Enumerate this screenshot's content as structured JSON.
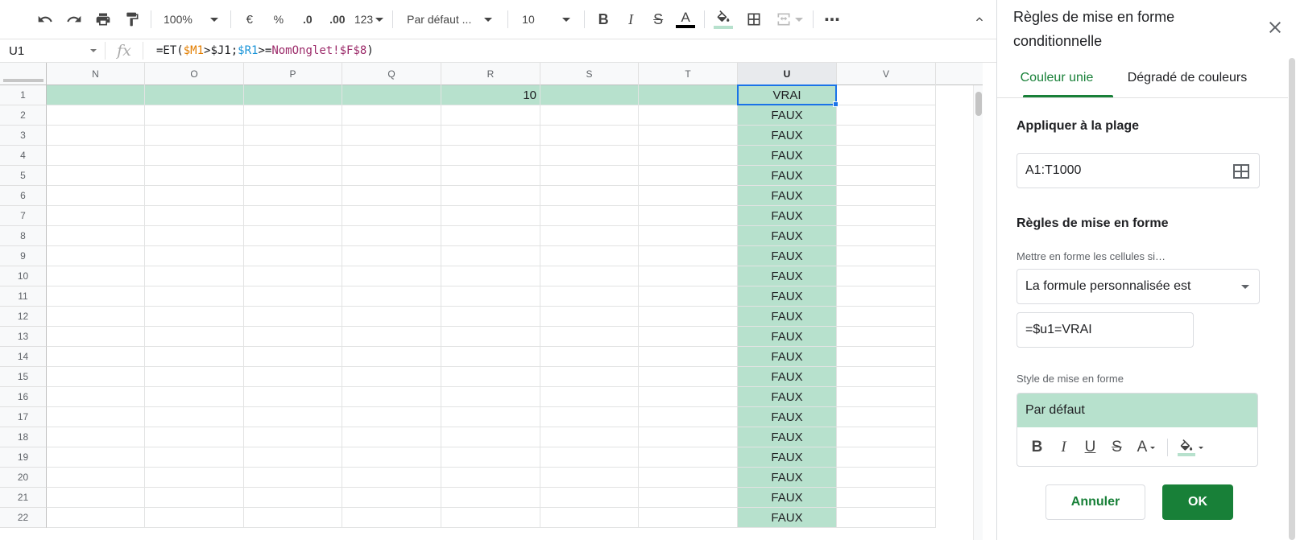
{
  "toolbar": {
    "zoom": "100%",
    "currency": "€",
    "percent": "%",
    "dec_decrease": ".0",
    "dec_increase": ".00",
    "format_more": "123",
    "font_family": "Par défaut ...",
    "font_size": "10",
    "bold": "B",
    "italic": "I",
    "strike": "S",
    "text_color": "A",
    "more": "⋯",
    "icons": [
      "undo-icon",
      "redo-icon",
      "print-icon",
      "paint-format-icon",
      "fill-color-icon",
      "borders-icon",
      "merge-icon",
      "chevron-up-icon"
    ]
  },
  "formula_bar": {
    "namebox": "U1",
    "fx": "fx",
    "formula": {
      "p1": "=ET(",
      "ref1": "$M1",
      "p2": ">$J1;",
      "ref2": "$R1",
      "p3": ">=",
      "ref3": "NomOnglet!$F$8",
      "p4": ")"
    }
  },
  "sheet": {
    "columns": [
      "N",
      "O",
      "P",
      "Q",
      "R",
      "S",
      "T",
      "U",
      "V"
    ],
    "active_column": "U",
    "rows": [
      {
        "n": "1",
        "R": "10",
        "U": "VRAI"
      },
      {
        "n": "2",
        "U": "FAUX"
      },
      {
        "n": "3",
        "U": "FAUX"
      },
      {
        "n": "4",
        "U": "FAUX"
      },
      {
        "n": "5",
        "U": "FAUX"
      },
      {
        "n": "6",
        "U": "FAUX"
      },
      {
        "n": "7",
        "U": "FAUX"
      },
      {
        "n": "8",
        "U": "FAUX"
      },
      {
        "n": "9",
        "U": "FAUX"
      },
      {
        "n": "10",
        "U": "FAUX"
      },
      {
        "n": "11",
        "U": "FAUX"
      },
      {
        "n": "12",
        "U": "FAUX"
      },
      {
        "n": "13",
        "U": "FAUX"
      },
      {
        "n": "14",
        "U": "FAUX"
      },
      {
        "n": "15",
        "U": "FAUX"
      },
      {
        "n": "16",
        "U": "FAUX"
      },
      {
        "n": "17",
        "U": "FAUX"
      },
      {
        "n": "18",
        "U": "FAUX"
      },
      {
        "n": "19",
        "U": "FAUX"
      },
      {
        "n": "20",
        "U": "FAUX"
      },
      {
        "n": "21",
        "U": "FAUX"
      },
      {
        "n": "22",
        "U": "FAUX"
      }
    ],
    "highlight_color": "#b7e1cd",
    "selection_color": "#1a73e8"
  },
  "panel": {
    "title": "Règles de mise en forme conditionnelle",
    "tabs": [
      {
        "label": "Couleur unie",
        "active": true
      },
      {
        "label": "Dégradé de couleurs",
        "active": false
      }
    ],
    "range_label": "Appliquer à la plage",
    "range_value": "A1:T1000",
    "rules_label": "Règles de mise en forme",
    "condition_label": "Mettre en forme les cellules si…",
    "condition_value": "La formule personnalisée est",
    "formula_value": "=$u1=VRAI",
    "style_label": "Style de mise en forme",
    "style_preview": "Par défaut",
    "style_tools": {
      "bold": "B",
      "italic": "I",
      "underline": "U",
      "strike": "S",
      "text_color": "A"
    },
    "cancel": "Annuler",
    "ok": "OK",
    "accent": "#188038"
  }
}
